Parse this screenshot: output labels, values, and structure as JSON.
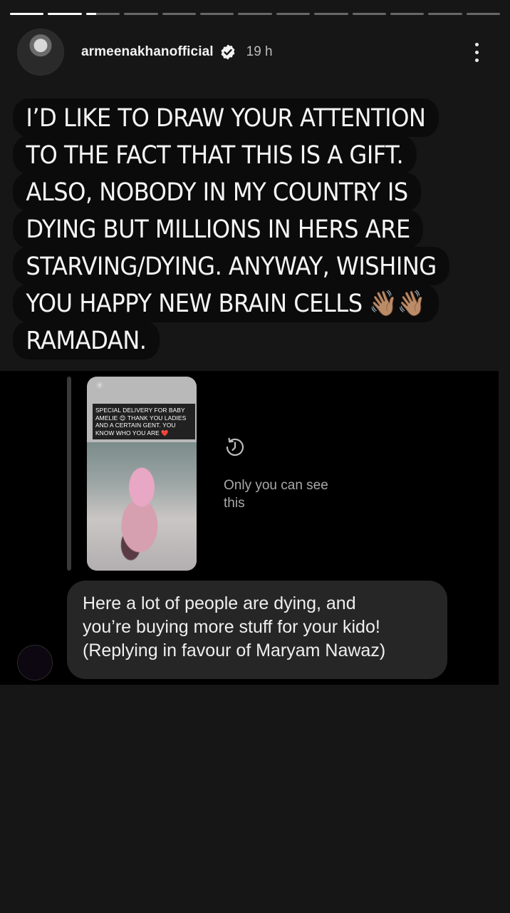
{
  "story": {
    "segments": [
      1,
      1,
      0.3,
      0,
      0,
      0,
      0,
      0,
      0,
      0,
      0,
      0,
      0
    ],
    "username": "armeenakhanofficial",
    "time": "19 h",
    "caption_lines": [
      "I’D LIKE TO DRAW YOUR ATTENTION",
      "TO THE FACT THAT THIS IS A GIFT.",
      "ALSO, NOBODY IN MY COUNTRY IS",
      "DYING BUT MILLIONS IN HERS ARE",
      "STARVING/DYING. ANYWAY, WISHING",
      "YOU HAPPY NEW BRAIN CELLS 👋🏽👋🏽",
      "RAMADAN."
    ]
  },
  "reply_panel": {
    "thumbnail_caption": "SPECIAL DELIVERY FOR BABY AMELIE 😊 THANK YOU LADIES AND A CERTAIN GENT. YOU KNOW WHO YOU ARE ❤️",
    "visibility_note": "Only you can see this",
    "reply_lines": [
      "Here a lot of people are dying, and",
      "you’re buying more stuff for your kido!",
      "(Replying in favour of Maryam Nawaz)"
    ]
  },
  "colors": {
    "background": "#161616",
    "panel": "#000000",
    "bubble": "#262626",
    "caption_bg": "#0b0b0b"
  },
  "icons": {
    "verified": "verified-badge-icon",
    "menu": "more-options-icon",
    "history": "history-clock-icon"
  }
}
